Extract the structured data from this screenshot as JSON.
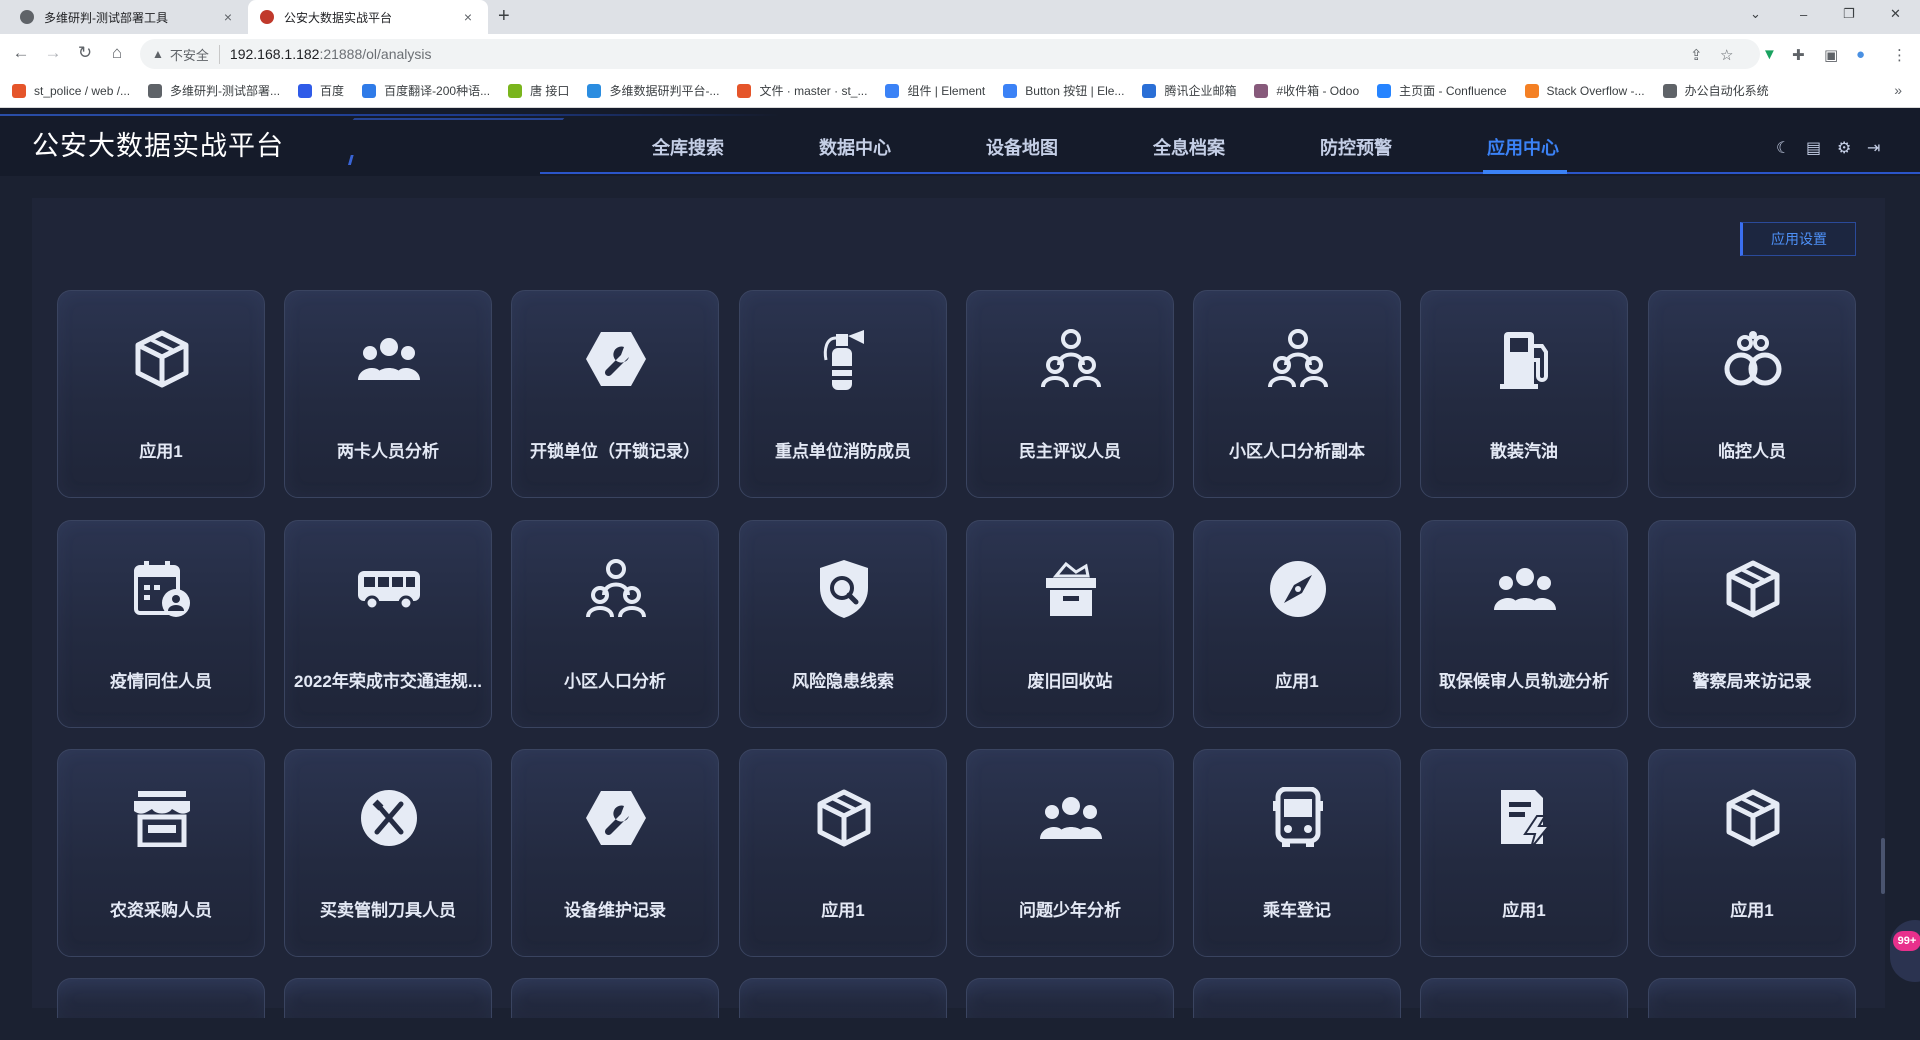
{
  "browser": {
    "tabs": [
      {
        "title": "多维研判-测试部署工具",
        "close": "×"
      },
      {
        "title": "公安大数据实战平台",
        "close": "×"
      }
    ],
    "new_tab": "+",
    "window_controls": [
      "⌄",
      "–",
      "❐",
      "✕"
    ],
    "address": {
      "warning_icon": "▲",
      "security_label": "不安全",
      "host": "192.168.1.182",
      "path": ":21888/ol/analysis"
    },
    "bookmarks": [
      {
        "label": "st_police / web /...",
        "color": "#e5552a"
      },
      {
        "label": "多维研判-测试部署...",
        "color": "#5f6368"
      },
      {
        "label": "百度",
        "color": "#2f5be8"
      },
      {
        "label": "百度翻译-200种语...",
        "color": "#2f7be8"
      },
      {
        "label": "唐 接口",
        "color": "#7ab51d"
      },
      {
        "label": "多维数据研判平台-...",
        "color": "#2b8de0"
      },
      {
        "label": "文件 · master · st_...",
        "color": "#e5552a"
      },
      {
        "label": "组件 | Element",
        "color": "#3b82f6"
      },
      {
        "label": "Button 按钮 | Ele...",
        "color": "#3b82f6"
      },
      {
        "label": "腾讯企业邮箱",
        "color": "#2a6fd6"
      },
      {
        "label": "#收件箱 - Odoo",
        "color": "#875a7b"
      },
      {
        "label": "主页面 - Confluence",
        "color": "#2684ff"
      },
      {
        "label": "Stack Overflow -...",
        "color": "#f48024"
      },
      {
        "label": "办公自动化系统",
        "color": "#5f6368"
      }
    ],
    "bookmarks_more": "»"
  },
  "app": {
    "title": "公安大数据实战平台",
    "nav": [
      {
        "label": "全库搜索",
        "active": false
      },
      {
        "label": "数据中心",
        "active": false
      },
      {
        "label": "设备地图",
        "active": false
      },
      {
        "label": "全息档案",
        "active": false
      },
      {
        "label": "防控预警",
        "active": false
      },
      {
        "label": "应用中心",
        "active": true
      }
    ],
    "header_icons": [
      "moon-icon",
      "clipboard-icon",
      "gear-icon",
      "logout-icon"
    ],
    "settings_button": "应用设置",
    "badge": "99+",
    "colors": {
      "accent": "#3b82f6",
      "icon": "#e6ebf5",
      "card_text": "#e4e9f5"
    }
  },
  "apps": [
    {
      "label": "应用1",
      "icon": "box-icon"
    },
    {
      "label": "两卡人员分析",
      "icon": "people-group-icon"
    },
    {
      "label": "开锁单位（开锁记录）",
      "icon": "wrench-hex-icon"
    },
    {
      "label": "重点单位消防成员",
      "icon": "fire-extinguisher-icon"
    },
    {
      "label": "民主评议人员",
      "icon": "people-tree-icon"
    },
    {
      "label": "小区人口分析副本",
      "icon": "people-tree-icon"
    },
    {
      "label": "散装汽油",
      "icon": "fuel-pump-icon"
    },
    {
      "label": "临控人员",
      "icon": "handcuffs-icon"
    },
    {
      "label": "疫情同住人员",
      "icon": "calendar-user-icon"
    },
    {
      "label": "2022年荣成市交通违规...",
      "icon": "bus-side-icon"
    },
    {
      "label": "小区人口分析",
      "icon": "people-tree-icon"
    },
    {
      "label": "风险隐患线索",
      "icon": "shield-search-icon"
    },
    {
      "label": "废旧回收站",
      "icon": "recycle-box-icon"
    },
    {
      "label": "应用1",
      "icon": "compass-icon"
    },
    {
      "label": "取保候审人员轨迹分析",
      "icon": "people-group-icon"
    },
    {
      "label": "警察局来访记录",
      "icon": "box-icon"
    },
    {
      "label": "农资采购人员",
      "icon": "store-icon"
    },
    {
      "label": "买卖管制刀具人员",
      "icon": "fork-knife-icon"
    },
    {
      "label": "设备维护记录",
      "icon": "wrench-hex-icon"
    },
    {
      "label": "应用1",
      "icon": "box-icon"
    },
    {
      "label": "问题少年分析",
      "icon": "people-group-icon"
    },
    {
      "label": "乘车登记",
      "icon": "bus-front-icon"
    },
    {
      "label": "应用1",
      "icon": "document-lightning-icon"
    },
    {
      "label": "应用1",
      "icon": "box-icon"
    }
  ]
}
